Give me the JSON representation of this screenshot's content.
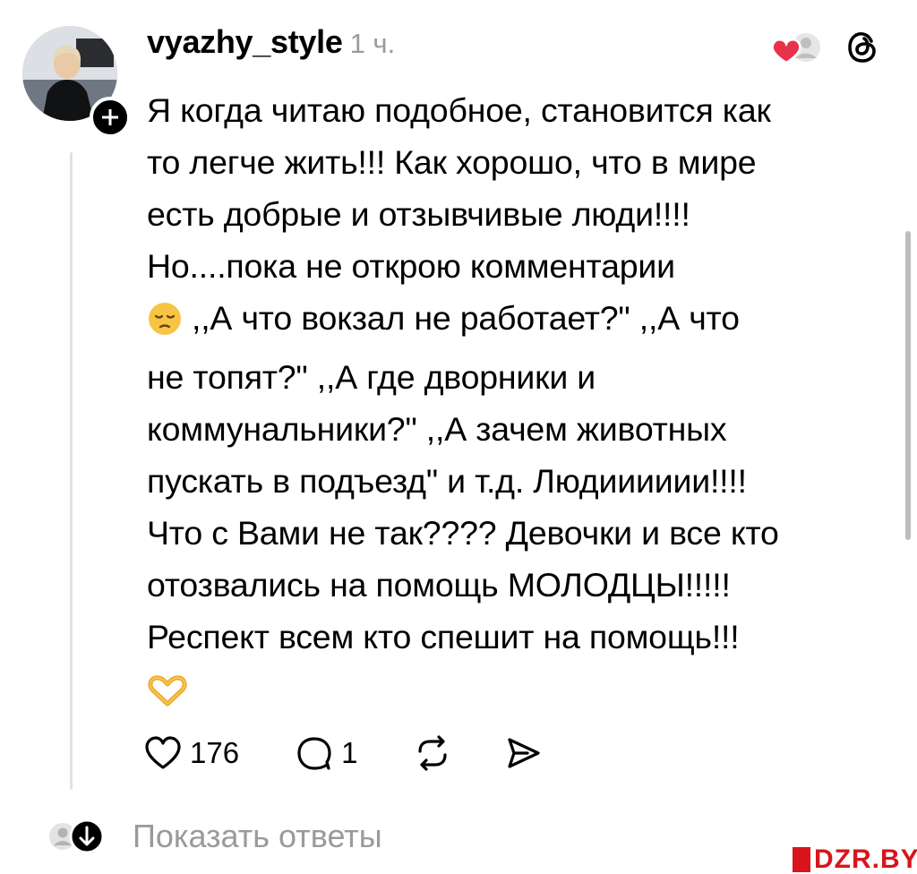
{
  "post": {
    "username": "vyazhy_style",
    "timestamp": "1 ч.",
    "lines": [
      "Я когда читаю подобное, становится как",
      "то легче жить!!! Как хорошо, что в мире",
      "есть добрые и отзывчивые люди!!!!",
      "Но....пока не открою комментарии",
      ",,А что вокзал не работает?\" ,,А что",
      "не топят?\" ,,А где дворники и",
      "коммунальники?\" ,,А зачем животных",
      "пускать в подъезд\" и т.д. Людииииии!!!!",
      "Что с Вами не так???? Девочки и все кто",
      "отозвались на помощь МОЛОДЦЫ!!!!!",
      "Респект всем кто спешит на помощь!!!"
    ],
    "emojis": [
      "pensive-face-emoji",
      "heart-hands-emoji"
    ]
  },
  "actions": {
    "like_count": "176",
    "reply_count": "1"
  },
  "show_replies_label": "Показать ответы",
  "watermark": {
    "text": "DZR.BY"
  },
  "colors": {
    "like_heart": "#e8324a",
    "muted_text": "#9a9a9a",
    "watermark": "#d9141b",
    "emoji_yellow": "#f7c543"
  }
}
